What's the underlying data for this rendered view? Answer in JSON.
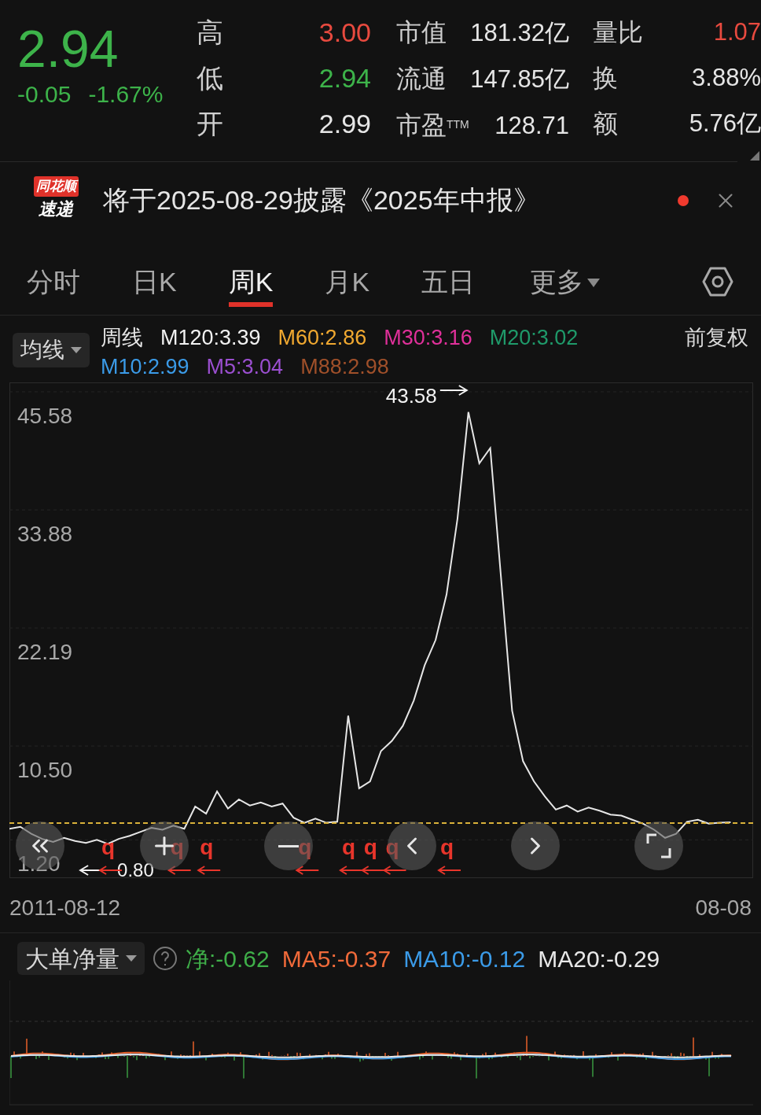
{
  "quote": {
    "price": "2.94",
    "change": "-0.05",
    "change_pct": "-1.67%",
    "color": "#3db34a"
  },
  "stats": [
    {
      "label": "高",
      "value": "3.00",
      "color": "#e84a3f"
    },
    {
      "label": "低",
      "value": "2.94",
      "color": "#3db34a"
    },
    {
      "label": "开",
      "value": "2.99",
      "color": "#e6e6e6"
    }
  ],
  "metrics": [
    {
      "label": "市值",
      "value": "181.32亿"
    },
    {
      "label": "流通",
      "value": "147.85亿"
    },
    {
      "label": "市盈$^{TTM}$",
      "value": "128.71"
    }
  ],
  "ratios": [
    {
      "label": "量比",
      "value": "1.07",
      "color": "#e84a3f"
    },
    {
      "label": "换",
      "value": "3.88%",
      "color": "#e6e6e6"
    },
    {
      "label": "额",
      "value": "5.76亿",
      "color": "#e6e6e6"
    }
  ],
  "notice": {
    "logo_top": "同花顺",
    "logo_bottom": "速递",
    "message": "将于2025-08-29披露《2025年中报》",
    "unread": true
  },
  "tabs": [
    {
      "label": "分时",
      "selected": false,
      "kind": "tab"
    },
    {
      "label": "日K",
      "selected": false,
      "kind": "tab"
    },
    {
      "label": "周K",
      "selected": true,
      "kind": "tab"
    },
    {
      "label": "月K",
      "selected": false,
      "kind": "tab"
    },
    {
      "label": "五日",
      "selected": false,
      "kind": "tab"
    },
    {
      "label": "更多",
      "selected": false,
      "kind": "menu"
    }
  ],
  "legend": {
    "dropdown": "均线",
    "adjust": "前复权",
    "averages": [
      {
        "label": "M120:3.39",
        "color": "#f2f2f2"
      },
      {
        "label": "M60:2.86",
        "color": "#f0a830"
      },
      {
        "label": "M30:3.16",
        "color": "#e0309a"
      },
      {
        "label": "M20:3.02",
        "color": "#1f9a6a"
      },
      {
        "label": "M10:2.99",
        "color": "#3b9be8"
      },
      {
        "label": "M5:3.04",
        "color": "#9b4fd0"
      },
      {
        "label": "M88:2.98",
        "color": "#a0502a"
      }
    ]
  },
  "chart": {
    "chart_data": {
      "type": "line",
      "grid": true,
      "ylim": [
        -2.59,
        46.51
      ],
      "yticks": [
        45.58,
        33.88,
        22.19,
        {
          "value": 10.5,
          "label": "10.50"
        },
        {
          "value": 1.2,
          "label": "1.20"
        }
      ],
      "series": [
        {
          "name": "周线",
          "color": "#e6e6e6",
          "values": [
            2.3,
            2.5,
            1.8,
            1.3,
            1.0,
            1.4,
            1.1,
            0.9,
            1.2,
            0.8,
            1.3,
            1.6,
            2.0,
            2.4,
            2.2,
            2.6,
            2.3,
            4.5,
            3.8,
            6.0,
            4.3,
            5.2,
            4.6,
            4.9,
            4.5,
            4.8,
            3.4,
            2.9,
            3.3,
            2.9,
            3.0,
            13.5,
            6.3,
            7.0,
            10.0,
            11.0,
            12.5,
            15.0,
            18.5,
            21.0,
            25.5,
            33.0,
            43.58,
            38.5,
            40.0,
            27.0,
            14.0,
            9.0,
            7.0,
            5.5,
            4.2,
            4.6,
            4.0,
            4.4,
            4.1,
            3.7,
            3.6,
            3.2,
            2.8,
            2.2,
            1.4,
            1.8,
            3.0,
            3.2,
            2.8,
            2.9,
            2.94
          ]
        }
      ]
    },
    "max_label": {
      "text": "43.58"
    },
    "min_label": {
      "text": "0.80"
    },
    "markers": [
      {
        "label": "q"
      },
      {
        "label": "q"
      },
      {
        "label": "q"
      },
      {
        "label": "q"
      },
      {
        "label": "q"
      },
      {
        "label": "q"
      },
      {
        "label": "q"
      },
      {
        "label": "q"
      }
    ],
    "date_start": "2011-08-12",
    "date_end": "08-08"
  },
  "flow": {
    "dropdown": "大单净量",
    "values": [
      {
        "label": "净:-0.62",
        "color": "#3fae49"
      },
      {
        "label": "MA5:-0.37",
        "color": "#f06a3a"
      },
      {
        "label": "MA10:-0.12",
        "color": "#3b9be8"
      },
      {
        "label": "MA20:-0.29",
        "color": "#e8e8e8"
      }
    ]
  }
}
